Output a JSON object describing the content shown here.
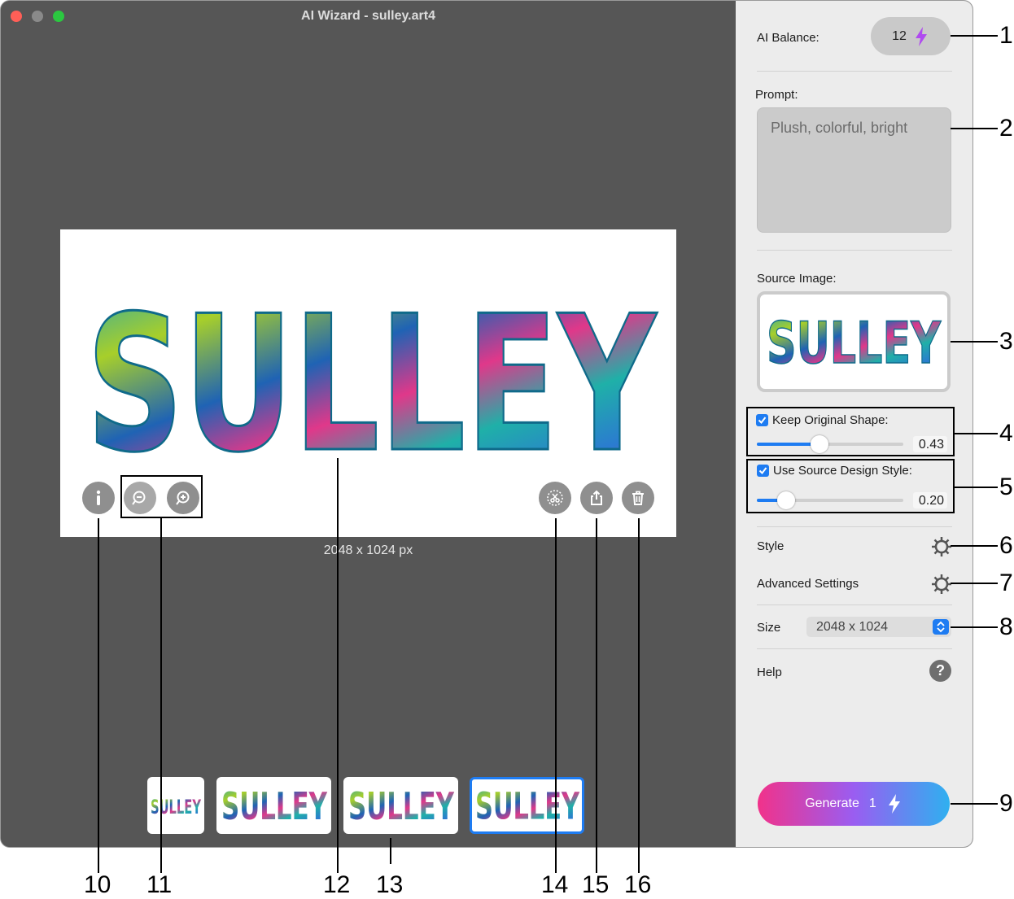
{
  "window": {
    "title": "AI Wizard - sulley.art4"
  },
  "canvas": {
    "art_text": "SULLEY",
    "dimensions": "2048 x 1024 px"
  },
  "thumbnails": [
    {
      "text": "SULLEY",
      "selected": false
    },
    {
      "text": "SULLEY",
      "selected": false
    },
    {
      "text": "SULLEY",
      "selected": false
    },
    {
      "text": "SULLEY",
      "selected": true
    }
  ],
  "panel": {
    "balance_label": "AI Balance:",
    "balance_value": "12",
    "prompt_label": "Prompt:",
    "prompt_value": "Plush, colorful, bright",
    "source_label": "Source Image:",
    "source_text": "SULLEY",
    "keep_shape_label": "Keep Original Shape:",
    "keep_shape_value": "0.43",
    "source_style_label": "Use Source Design Style:",
    "source_style_value": "0.20",
    "style_label": "Style",
    "advanced_label": "Advanced Settings",
    "size_label": "Size",
    "size_value": "2048 x 1024",
    "help_label": "Help",
    "generate_label": "Generate",
    "generate_cost": "1"
  },
  "callouts": [
    "1",
    "2",
    "3",
    "4",
    "5",
    "6",
    "7",
    "8",
    "9",
    "10",
    "11",
    "12",
    "13",
    "14",
    "15",
    "16"
  ],
  "colors": {
    "accent": "#1e7cf2",
    "lightning": "#b04af0"
  }
}
